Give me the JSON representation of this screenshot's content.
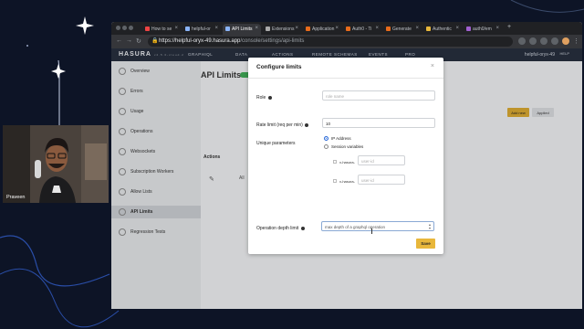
{
  "browser": {
    "tabs": [
      {
        "label": "How to se"
      },
      {
        "label": "helpful-or"
      },
      {
        "label": "API Limits"
      },
      {
        "label": "Extensions"
      },
      {
        "label": "Application"
      },
      {
        "label": "Auth0 - Ti"
      },
      {
        "label": "Generate"
      },
      {
        "label": "Authentic"
      },
      {
        "label": "auth0/em"
      }
    ],
    "url_host": "https://helpful-oryx-49.hasura.app",
    "url_path": "/console/settings/api-limits"
  },
  "hasura": {
    "logo": "HASURA",
    "version": "v2.5.0-cloud.2",
    "nav": [
      "GRAPHIQL",
      "DATA",
      "ACTIONS",
      "REMOTE SCHEMAS",
      "EVENTS",
      "PRO"
    ],
    "project": "helpful-oryx-49",
    "help": "HELP",
    "sidebar": [
      "Overview",
      "Errors",
      "Usage",
      "Operations",
      "Websockets",
      "Subscription Workers",
      "Allow Lists",
      "API Limits",
      "Regression Tests"
    ],
    "page_title": "API Limits",
    "add_new": "Add new",
    "applied": "Applied",
    "actions_header": "Actions",
    "row_partial": "All"
  },
  "modal": {
    "title": "Configure limits",
    "close": "×",
    "role_label": "Role",
    "role_placeholder": "role name",
    "rate_label": "Rate limit (req per min)",
    "rate_value": "10",
    "unique_label": "Unique parameters",
    "opt_ip": "IP Address",
    "opt_session": "Session variables",
    "hdr_prefix_1": "x-hasura-",
    "hdr_placeholder_1": "user-id",
    "hdr_prefix_2": "x-hasura-",
    "hdr_placeholder_2": "user-id",
    "depth_label": "Operation depth limit",
    "depth_placeholder": "max depth of a graphql operation",
    "save": "Save"
  },
  "webcam": {
    "name": "Praveen"
  }
}
